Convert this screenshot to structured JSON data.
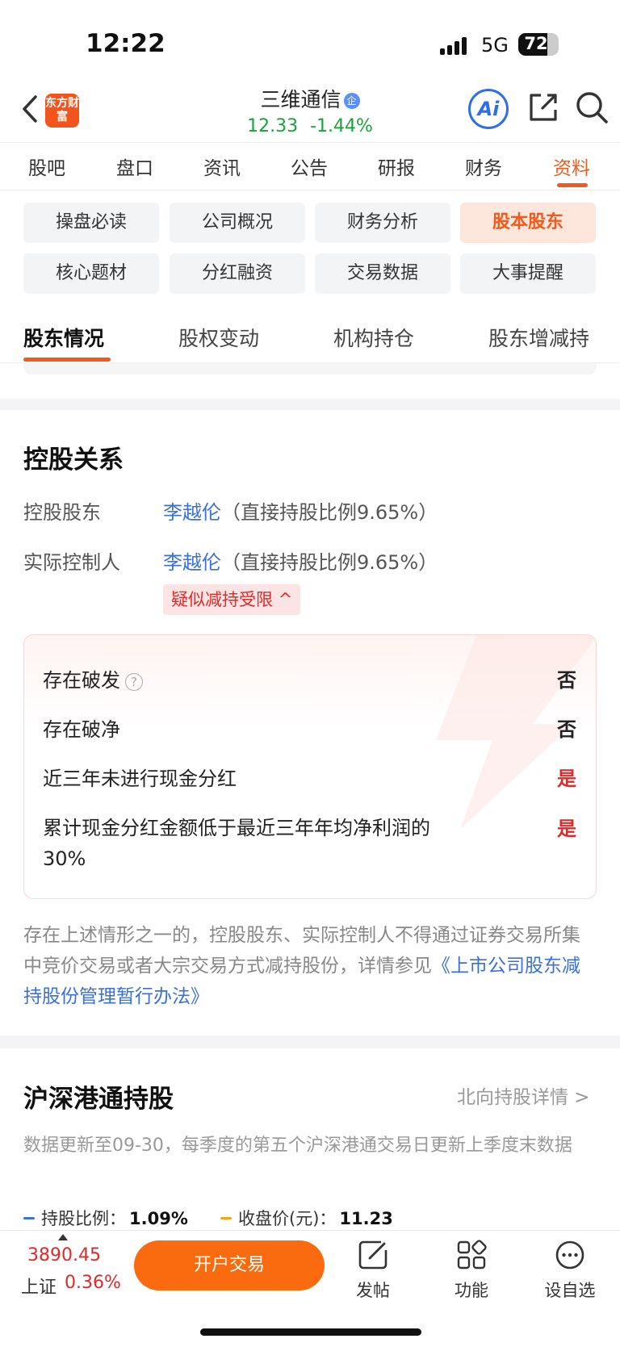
{
  "status": {
    "time": "12:22",
    "network": "5G",
    "battery": "72",
    "battery_level": 0.72
  },
  "header": {
    "logo": "东方财富",
    "stock_name": "三维通信",
    "badge": "企",
    "price": "12.33",
    "change": "-1.44%",
    "ai_label": "Ai"
  },
  "tabs": [
    "股吧",
    "盘口",
    "资讯",
    "公告",
    "研报",
    "财务",
    "资料"
  ],
  "active_tab": "资料",
  "chips": [
    "操盘必读",
    "公司概况",
    "财务分析",
    "股本股东",
    "核心题材",
    "分红融资",
    "交易数据",
    "大事提醒"
  ],
  "active_chip": "股本股东",
  "subtabs": [
    "股东情况",
    "股权变动",
    "机构持仓",
    "股东增减持"
  ],
  "control": {
    "title": "控股关系",
    "rows": [
      {
        "label": "控股股东",
        "name": "李越伦",
        "detail": "（直接持股比例9.65%）"
      },
      {
        "label": "实际控制人",
        "name": "李越伦",
        "detail": "（直接持股比例9.65%）"
      }
    ],
    "warning": "疑似减持受限 ^"
  },
  "risks": [
    {
      "label": "存在破发",
      "value": "否",
      "help": true
    },
    {
      "label": "存在破净",
      "value": "否"
    },
    {
      "label": "近三年未进行现金分红",
      "value": "是"
    },
    {
      "label": "累计现金分红金额低于最近三年年均净利润的",
      "label2": "30%",
      "value": "是"
    }
  ],
  "note": {
    "text": "存在上述情形之一的，控股股东、实际控制人不得通过证券交易所集中竞价交易或者大宗交易方式减持股份，详情参见",
    "link": "《上市公司股东减持股份管理暂行办法》"
  },
  "hk_connect": {
    "title": "沪深港通持股",
    "more": "北向持股详情 >",
    "data_note": "数据更新至09-30，每季度的第五个沪深港通交易日更新上季度末数据",
    "legend": [
      {
        "label": "持股比例：",
        "value": "1.09%",
        "color": "#3a70d9"
      },
      {
        "label": "收盘价(元)：",
        "value": "11.23",
        "color": "#f5a623"
      }
    ]
  },
  "bottom": {
    "index_value": "3890.45",
    "index_name": "上证",
    "index_change": "0.36%",
    "open_button": "开户交易",
    "nav": [
      "发帖",
      "功能",
      "设自选"
    ]
  }
}
